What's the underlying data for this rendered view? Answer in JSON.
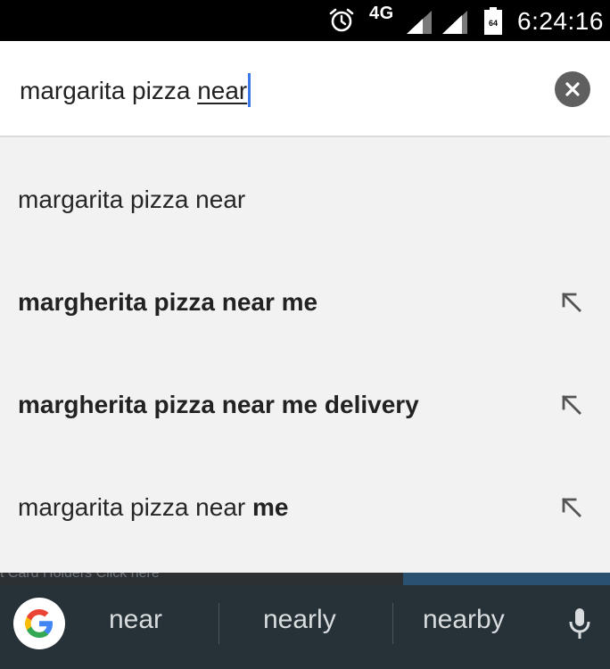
{
  "status_bar": {
    "network": "4G",
    "battery_level": "64",
    "time": "6:24:16"
  },
  "search": {
    "query_prefix": "margarita pizza ",
    "query_highlight": "near"
  },
  "suggestions": [
    {
      "parts": [
        {
          "text": "margarita pizza near",
          "bold": false
        }
      ],
      "has_fill_arrow": false
    },
    {
      "parts": [
        {
          "text": "margherita pizza near me",
          "bold": true
        }
      ],
      "has_fill_arrow": true
    },
    {
      "parts": [
        {
          "text": "margherita pizza near me delivery",
          "bold": true
        }
      ],
      "has_fill_arrow": true
    },
    {
      "parts": [
        {
          "text": "margarita pizza near ",
          "bold": false
        },
        {
          "text": "me",
          "bold": true
        }
      ],
      "has_fill_arrow": true
    }
  ],
  "background_peek_text": "t Card Holders Click here",
  "keyboard": {
    "suggestions": [
      "near",
      "nearly",
      "nearby"
    ]
  },
  "colors": {
    "status_bar": "#000000",
    "search_background": "#ffffff",
    "suggestion_background": "#f2f2f2",
    "keyboard_background": "#263238",
    "caret": "#3b78e7"
  }
}
